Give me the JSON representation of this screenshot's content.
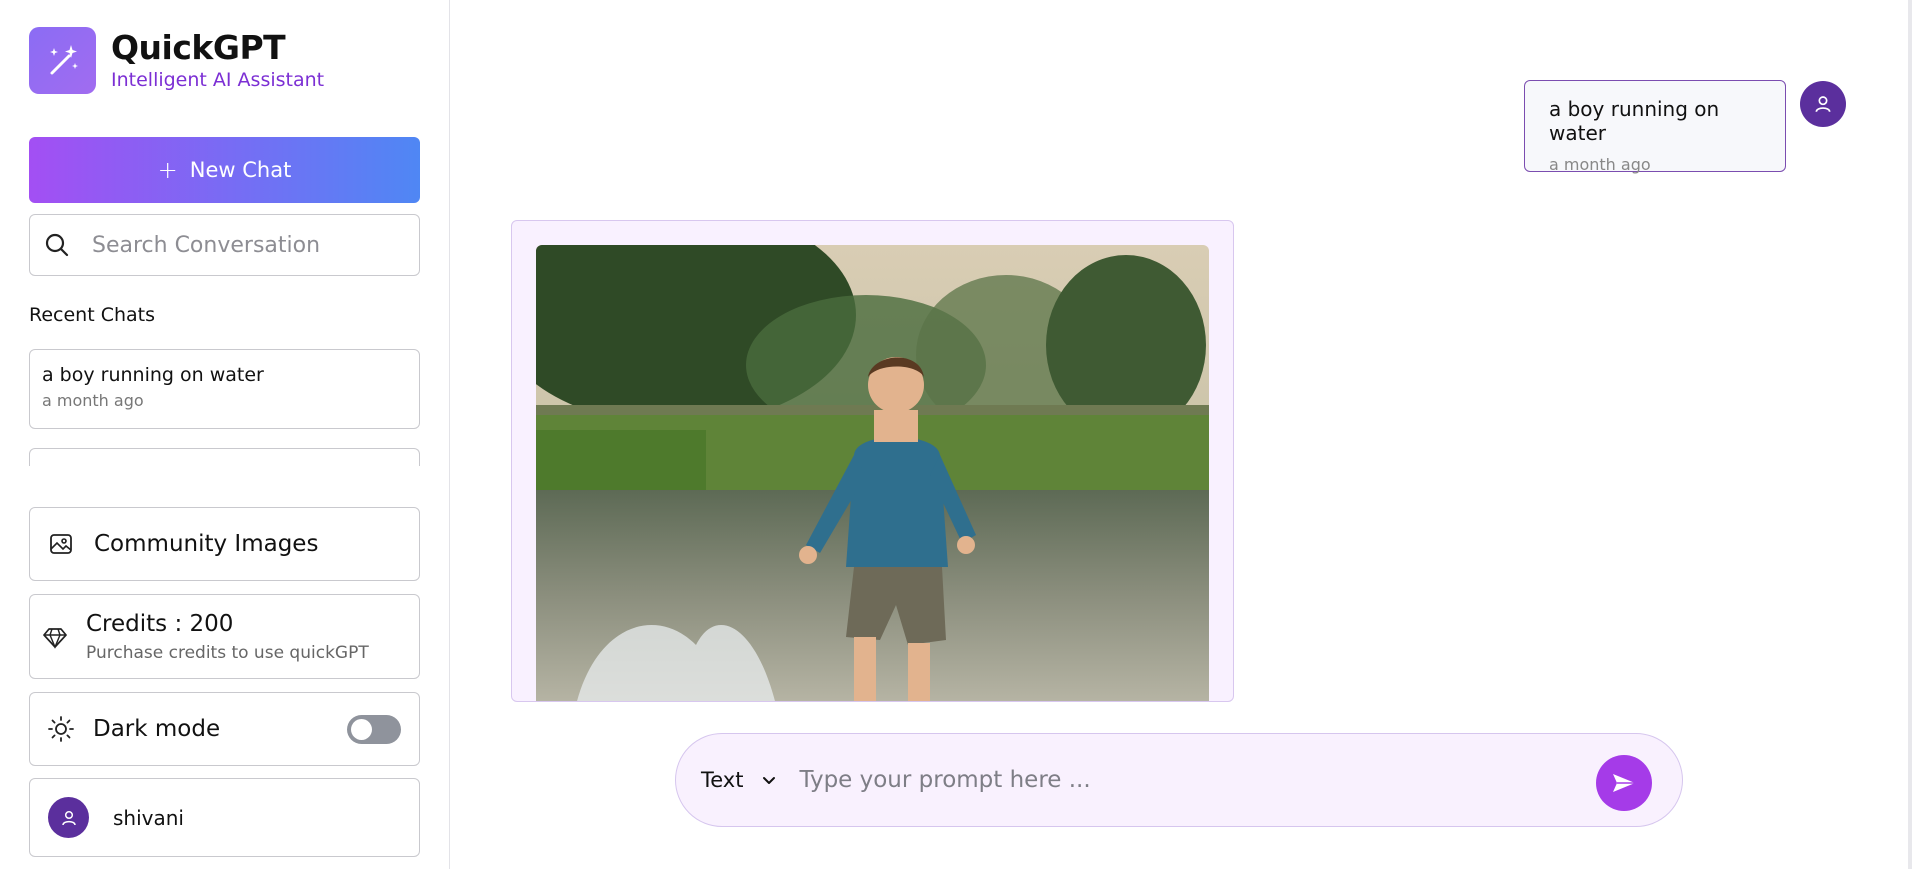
{
  "brand": {
    "title": "QuickGPT",
    "subtitle": "Intelligent AI Assistant",
    "accent_color": "#7c2fd4",
    "logo_icon": "magic-wand-sparkles-icon"
  },
  "sidebar": {
    "new_chat_label": "New Chat",
    "search_placeholder": "Search Conversation",
    "recent_title": "Recent Chats",
    "recent_chats": [
      {
        "title": "a boy running on water",
        "time": "a month ago"
      }
    ],
    "community_label": "Community Images",
    "credits": {
      "label": "Credits : 200",
      "subtitle": "Purchase credits to use quickGPT"
    },
    "dark_mode": {
      "label": "Dark mode",
      "enabled": false
    },
    "user": {
      "name": "shivani"
    }
  },
  "conversation": {
    "messages": [
      {
        "role": "user",
        "text": "a boy running on water",
        "time": "a month ago"
      },
      {
        "role": "assistant",
        "type": "image",
        "image_icon": "generated-image-boy-running-on-water"
      }
    ]
  },
  "prompt": {
    "mode_selected": "Text",
    "placeholder": "Type your prompt here ...",
    "send_icon": "send-icon"
  },
  "colors": {
    "gradient_start": "#a34ff3",
    "gradient_end": "#4f87f4",
    "send_button": "#a53be8",
    "avatar": "#5b2f9d"
  }
}
